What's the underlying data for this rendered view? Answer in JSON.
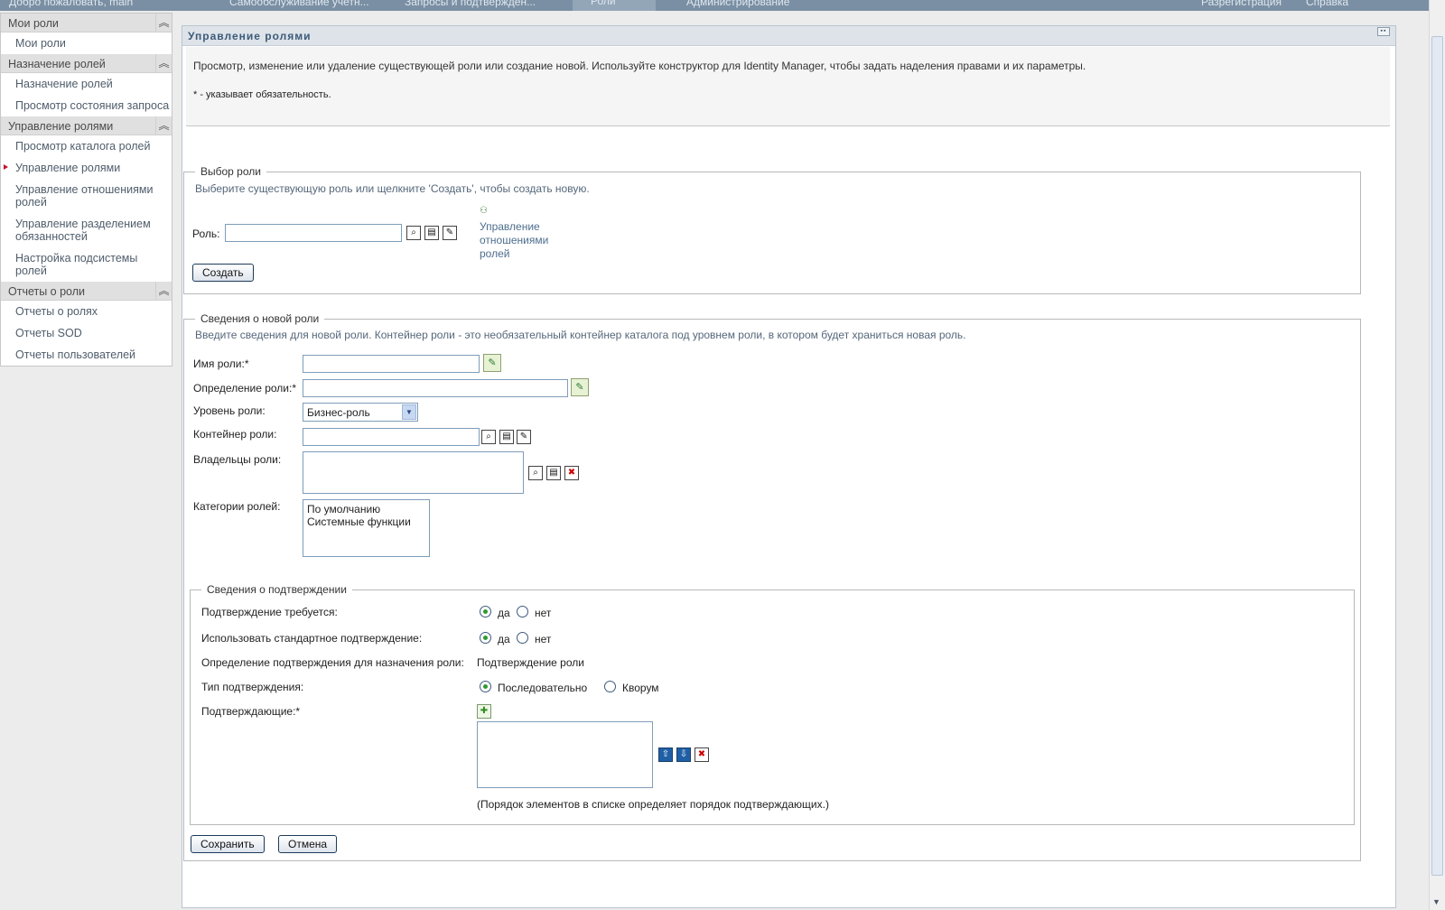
{
  "topbar": {
    "welcome": "Добро пожаловать, main",
    "tabs": [
      "Самообслуживание учетн...",
      "Запросы и подтвержден...",
      "Роли",
      "Администрирование"
    ],
    "right_links": [
      "Разрегистрация",
      "Справка"
    ]
  },
  "sidebar": {
    "sections": [
      {
        "title": "Мои роли",
        "items": [
          "Мои роли"
        ]
      },
      {
        "title": "Назначение ролей",
        "items": [
          "Назначение ролей",
          "Просмотр состояния запроса"
        ]
      },
      {
        "title": "Управление ролями",
        "items": [
          "Просмотр каталога ролей",
          "Управление ролями",
          "Управление отношениями ролей",
          "Управление разделением обязанностей",
          "Настройка подсистемы ролей"
        ]
      },
      {
        "title": "Отчеты о роли",
        "items": [
          "Отчеты о ролях",
          "Отчеты SOD",
          "Отчеты пользователей"
        ]
      }
    ],
    "active_item": "Управление ролями"
  },
  "panel": {
    "title": "Управление ролями",
    "description": "Просмотр, изменение или удаление существующей роли или создание новой. Используйте конструктор для Identity Manager, чтобы задать наделения правами и их параметры.",
    "required_note": "* - указывает обязательность."
  },
  "role_select": {
    "legend": "Выбор роли",
    "hint": "Выберите существующую роль или щелкните 'Создать', чтобы создать новую.",
    "role_label": "Роль:",
    "role_value": "",
    "relations_link": "Управление отношениями ролей",
    "create_button": "Создать"
  },
  "new_role": {
    "legend": "Сведения о новой роли",
    "hint": "Введите сведения для новой роли. Контейнер роли - это необязательный контейнер каталога под уровнем роли, в котором будет храниться новая роль.",
    "name_label": "Имя роли:*",
    "definition_label": "Определение роли:*",
    "level_label": "Уровень роли:",
    "level_value": "Бизнес-роль",
    "container_label": "Контейнер роли:",
    "owners_label": "Владельцы роли:",
    "categories_label": "Категории ролей:",
    "categories": [
      "По умолчанию",
      "Системные функции"
    ]
  },
  "approval": {
    "legend": "Сведения о подтверждении",
    "required_label": "Подтверждение требуется:",
    "standard_label": "Использовать стандартное подтверждение:",
    "yes": "да",
    "no": "нет",
    "definition_label": "Определение подтверждения для назначения роли:",
    "definition_value": "Подтверждение роли",
    "type_label": "Тип подтверждения:",
    "type_sequential": "Последовательно",
    "type_quorum": "Кворум",
    "approvers_label": "Подтверждающие:*",
    "order_note": "(Порядок элементов в списке определяет порядок подтверждающих.)"
  },
  "actions": {
    "save": "Сохранить",
    "cancel": "Отмена"
  },
  "icons": {
    "search": "search-icon",
    "browse": "object-browser-icon",
    "history": "edit-history-icon",
    "localize": "localize-icon",
    "remove": "remove-icon",
    "add": "add-icon",
    "up": "move-up-icon",
    "down": "move-down-icon"
  }
}
